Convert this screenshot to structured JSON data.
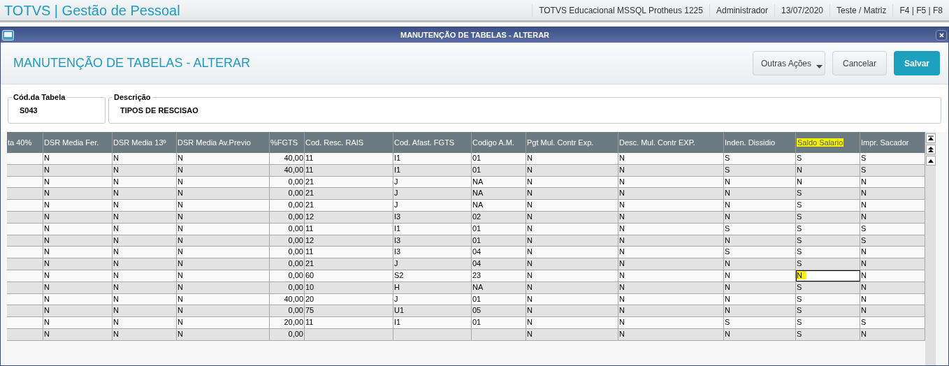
{
  "app_bar": {
    "title": "TOTVS | Gestão de Pessoal",
    "status": [
      "TOTVS Educacional MSSQL Protheus 1225",
      "Administrador",
      "13/07/2020",
      "Teste / Matriz",
      "F4 | F5 | F8"
    ]
  },
  "window": {
    "title": "MANUTENÇÃO DE TABELAS - ALTERAR"
  },
  "page": {
    "title": "MANUTENÇÃO DE TABELAS - ALTERAR",
    "actions": [
      {
        "label": "Outras Ações",
        "kind": "menu"
      },
      {
        "label": "Cancelar",
        "kind": "plain"
      },
      {
        "label": "Salvar",
        "kind": "primary"
      }
    ]
  },
  "fields": [
    {
      "label": "Cód.da Tabela",
      "value": "S043"
    },
    {
      "label": "Descrição",
      "value": "TIPOS DE RESCISAO"
    }
  ],
  "table": {
    "columns": [
      {
        "label": "ta 40%",
        "kind": "text",
        "highlighted": false
      },
      {
        "label": "DSR Media Fer.",
        "kind": "text",
        "highlighted": false
      },
      {
        "label": "DSR Media 13º",
        "kind": "text",
        "highlighted": false
      },
      {
        "label": "DSR Media Av.Previo",
        "kind": "text",
        "highlighted": false
      },
      {
        "label": "%FGTS",
        "kind": "number",
        "highlighted": false
      },
      {
        "label": "Cod. Resc. RAIS",
        "kind": "text",
        "highlighted": false
      },
      {
        "label": "Cod. Afast. FGTS",
        "kind": "text",
        "highlighted": false
      },
      {
        "label": "Codigo A.M.",
        "kind": "text",
        "highlighted": false
      },
      {
        "label": "Pgt Mul. Contr Exp.",
        "kind": "text",
        "highlighted": false
      },
      {
        "label": "Desc. Mul. Contr EXP.",
        "kind": "text",
        "highlighted": false
      },
      {
        "label": "Inden. Dissidio",
        "kind": "text",
        "highlighted": false
      },
      {
        "label": "Saldo Salario",
        "kind": "text",
        "highlighted": true
      },
      {
        "label": "Impr. Sacador",
        "kind": "text",
        "highlighted": false
      }
    ],
    "rows": [
      {
        "selected": false,
        "cells": [
          null,
          "N",
          "N",
          "N",
          "40,00",
          "11",
          "I1",
          "01",
          "N",
          "N",
          "S",
          "S",
          "S"
        ]
      },
      {
        "selected": false,
        "cells": [
          null,
          "N",
          "N",
          "N",
          "40,00",
          "11",
          "I1",
          "01",
          "N",
          "N",
          "S",
          "N",
          "S"
        ]
      },
      {
        "selected": false,
        "cells": [
          null,
          "N",
          "N",
          "N",
          "0,00",
          "21",
          "J",
          "NA",
          "N",
          "N",
          "N",
          "N",
          "N"
        ]
      },
      {
        "selected": false,
        "cells": [
          null,
          "N",
          "N",
          "N",
          "0,00",
          "21",
          "J",
          "NA",
          "N",
          "N",
          "N",
          "S",
          "N"
        ]
      },
      {
        "selected": false,
        "cells": [
          null,
          "N",
          "N",
          "N",
          "0,00",
          "21",
          "J",
          "NA",
          "N",
          "N",
          "N",
          "S",
          "N"
        ]
      },
      {
        "selected": false,
        "cells": [
          null,
          "N",
          "N",
          "N",
          "0,00",
          "12",
          "I3",
          "02",
          "N",
          "N",
          "N",
          "S",
          "N"
        ]
      },
      {
        "selected": false,
        "cells": [
          null,
          "N",
          "N",
          "N",
          "0,00",
          "11",
          "I1",
          "01",
          "N",
          "N",
          "S",
          "S",
          "S"
        ]
      },
      {
        "selected": false,
        "cells": [
          null,
          "N",
          "N",
          "N",
          "0,00",
          "12",
          "I3",
          "01",
          "N",
          "N",
          "N",
          "S",
          "S"
        ]
      },
      {
        "selected": false,
        "cells": [
          null,
          "N",
          "N",
          "N",
          "0,00",
          "11",
          "I3",
          "04",
          "N",
          "N",
          "S",
          "S",
          "N"
        ]
      },
      {
        "selected": false,
        "cells": [
          null,
          "N",
          "N",
          "N",
          "0,00",
          "21",
          "J",
          "04",
          "N",
          "N",
          "N",
          "S",
          "N"
        ]
      },
      {
        "selected": true,
        "cells": [
          null,
          "N",
          "N",
          "N",
          "0,00",
          "60",
          "S2",
          "23",
          "N",
          "N",
          "N",
          "N",
          "N"
        ]
      },
      {
        "selected": false,
        "cells": [
          null,
          "N",
          "N",
          "N",
          "0,00",
          "10",
          "H",
          "NA",
          "N",
          "N",
          "N",
          "S",
          "N"
        ]
      },
      {
        "selected": false,
        "cells": [
          null,
          "N",
          "N",
          "N",
          "40,00",
          "20",
          "J",
          "01",
          "N",
          "N",
          "N",
          "S",
          "N"
        ]
      },
      {
        "selected": false,
        "cells": [
          null,
          "N",
          "N",
          "N",
          "0,00",
          "75",
          "U1",
          "05",
          "N",
          "N",
          "N",
          "S",
          "N"
        ]
      },
      {
        "selected": false,
        "cells": [
          null,
          "N",
          "N",
          "N",
          "20,00",
          "11",
          "I1",
          "01",
          "N",
          "N",
          "S",
          "S",
          "S"
        ]
      },
      {
        "selected": false,
        "cells": [
          null,
          "N",
          "N",
          "N",
          "0,00",
          null,
          null,
          null,
          "N",
          "N",
          "N",
          "S",
          "N"
        ]
      }
    ]
  }
}
